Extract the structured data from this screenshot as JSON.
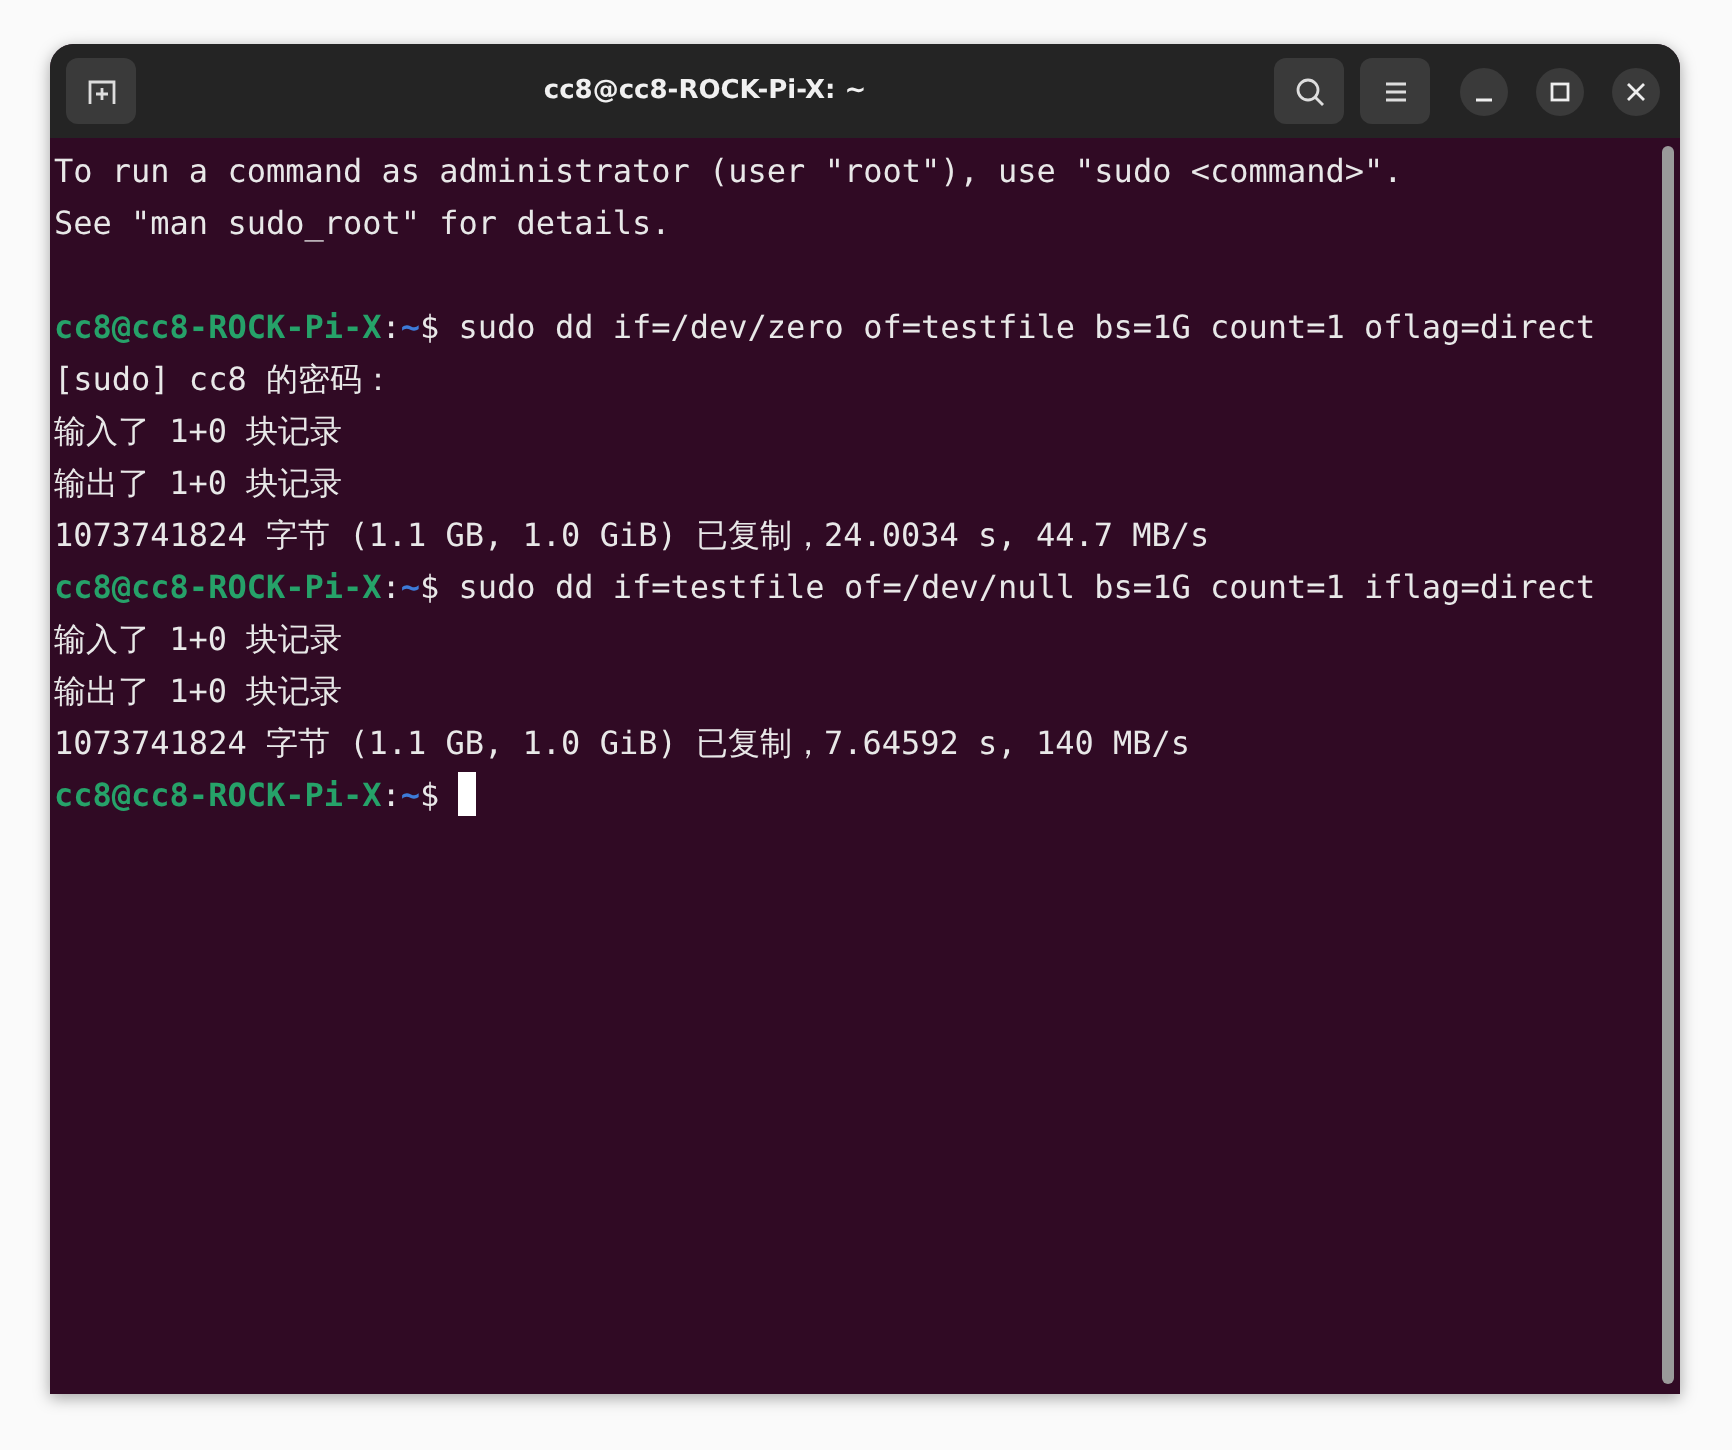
{
  "window": {
    "title": "cc8@cc8-ROCK-Pi-X: ~"
  },
  "terminal": {
    "lines": [
      {
        "kind": "text",
        "text": "To run a command as administrator (user \"root\"), use \"sudo <command>\"."
      },
      {
        "kind": "text",
        "text": "See \"man sudo_root\" for details."
      },
      {
        "kind": "blank"
      },
      {
        "kind": "prompt",
        "user_host": "cc8@cc8-ROCK-Pi-X",
        "separator": ":",
        "path": "~",
        "symbol": "$",
        "command": "sudo dd if=/dev/zero of=testfile bs=1G count=1 oflag=direct",
        "cursor": false
      },
      {
        "kind": "text",
        "text": "[sudo] cc8 的密码："
      },
      {
        "kind": "text",
        "text": "输入了 1+0 块记录"
      },
      {
        "kind": "text",
        "text": "输出了 1+0 块记录"
      },
      {
        "kind": "text",
        "text": "1073741824 字节 (1.1 GB, 1.0 GiB) 已复制，24.0034 s, 44.7 MB/s"
      },
      {
        "kind": "prompt",
        "user_host": "cc8@cc8-ROCK-Pi-X",
        "separator": ":",
        "path": "~",
        "symbol": "$",
        "command": "sudo dd if=testfile of=/dev/null bs=1G count=1 iflag=direct",
        "cursor": false
      },
      {
        "kind": "text",
        "text": "输入了 1+0 块记录"
      },
      {
        "kind": "text",
        "text": "输出了 1+0 块记录"
      },
      {
        "kind": "text",
        "text": "1073741824 字节 (1.1 GB, 1.0 GiB) 已复制，7.64592 s, 140 MB/s"
      },
      {
        "kind": "prompt",
        "user_host": "cc8@cc8-ROCK-Pi-X",
        "separator": ":",
        "path": "~",
        "symbol": "$",
        "cursor": true
      }
    ]
  }
}
